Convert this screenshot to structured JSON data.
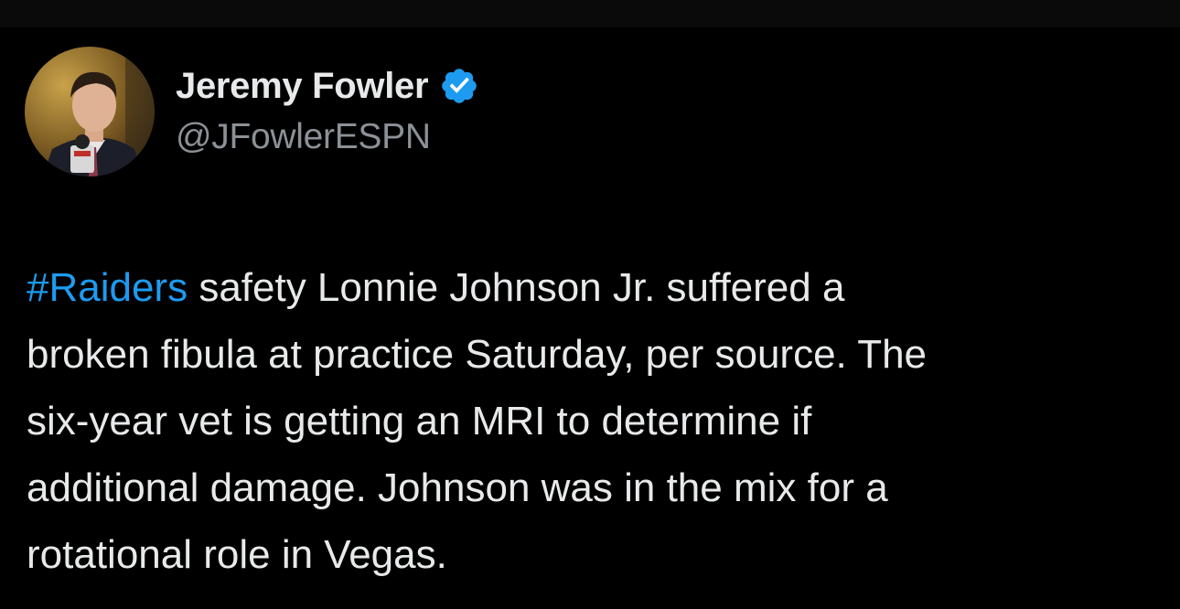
{
  "colors": {
    "background": "#000000",
    "text": "#e7e9ea",
    "secondary_text": "#8b9196",
    "link": "#1d9bf0",
    "verified_badge": "#1d9bf0"
  },
  "author": {
    "display_name": "Jeremy Fowler",
    "handle": "@JFowlerESPN",
    "verified": true,
    "verified_icon": "verified-badge-icon",
    "avatar_icon": "profile-photo"
  },
  "tweet": {
    "hashtag": "#Raiders",
    "line1_rest": " safety Lonnie Johnson Jr. suffered a",
    "line2": "broken fibula at practice Saturday, per source. The",
    "line3": "six-year vet is getting an MRI to determine if",
    "line4": "additional damage. Johnson was in the mix for a",
    "line5": "rotational role in Vegas."
  }
}
